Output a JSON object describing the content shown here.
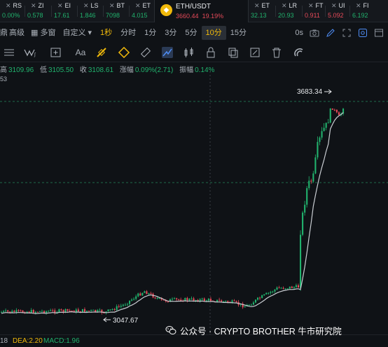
{
  "tickers": [
    {
      "name": "RS",
      "value": "0.00%",
      "color": "green"
    },
    {
      "name": "ZI",
      "value": "0.578",
      "color": "green"
    },
    {
      "name": "EI",
      "value": "17.61",
      "color": "green"
    },
    {
      "name": "LS",
      "value": "1.846",
      "color": "green"
    },
    {
      "name": "BT",
      "value": "7098",
      "color": "green"
    },
    {
      "name": "ET",
      "value": "4.015",
      "color": "green"
    }
  ],
  "active_ticker": {
    "name": "ETH/USDT",
    "price": "3660.44",
    "change": "19.19%"
  },
  "tickers_right": [
    {
      "name": "ET",
      "value": "32.13",
      "color": "green"
    },
    {
      "name": "LR",
      "value": "20.93",
      "color": "green"
    },
    {
      "name": "FT",
      "value": "0.911",
      "color": "red"
    },
    {
      "name": "UI",
      "value": "5.092",
      "color": "red"
    },
    {
      "name": "FI",
      "value": "6.192",
      "color": "green"
    }
  ],
  "timeframes": {
    "lead": "鼎",
    "items": [
      "高级",
      "多窗",
      "自定义 ▾",
      "1秒",
      "分时",
      "1分",
      "3分",
      "5分",
      "10分",
      "15分"
    ],
    "highlighted": "1秒",
    "active": "10分",
    "right_label": "0s"
  },
  "info": {
    "high_label": "高",
    "high": "3109.96",
    "low_label": "低",
    "low": "3105.50",
    "close_label": "收",
    "close": "3108.61",
    "change_label": "涨幅",
    "change": "0.09%(2.71)",
    "amp_label": "振幅",
    "amp": "0.14%",
    "ma_prefix": "53"
  },
  "chart_annotations": {
    "high_mark": "3683.34",
    "low_mark": "3047.67"
  },
  "chart_data": {
    "type": "candlestick",
    "title": "",
    "high_label": 3683.34,
    "low_label": 3047.67,
    "price_range": [
      3000,
      3700
    ]
  },
  "bottom": {
    "left": "18",
    "dea": "DEA:2.20",
    "macd": "MACD:1.96"
  },
  "watermark": "公众号 · CRYPTO BROTHER 牛市研究院",
  "colors": {
    "up": "#21b26d",
    "down": "#e54a59",
    "accent": "#f0b90b",
    "background": "#0f1216"
  }
}
